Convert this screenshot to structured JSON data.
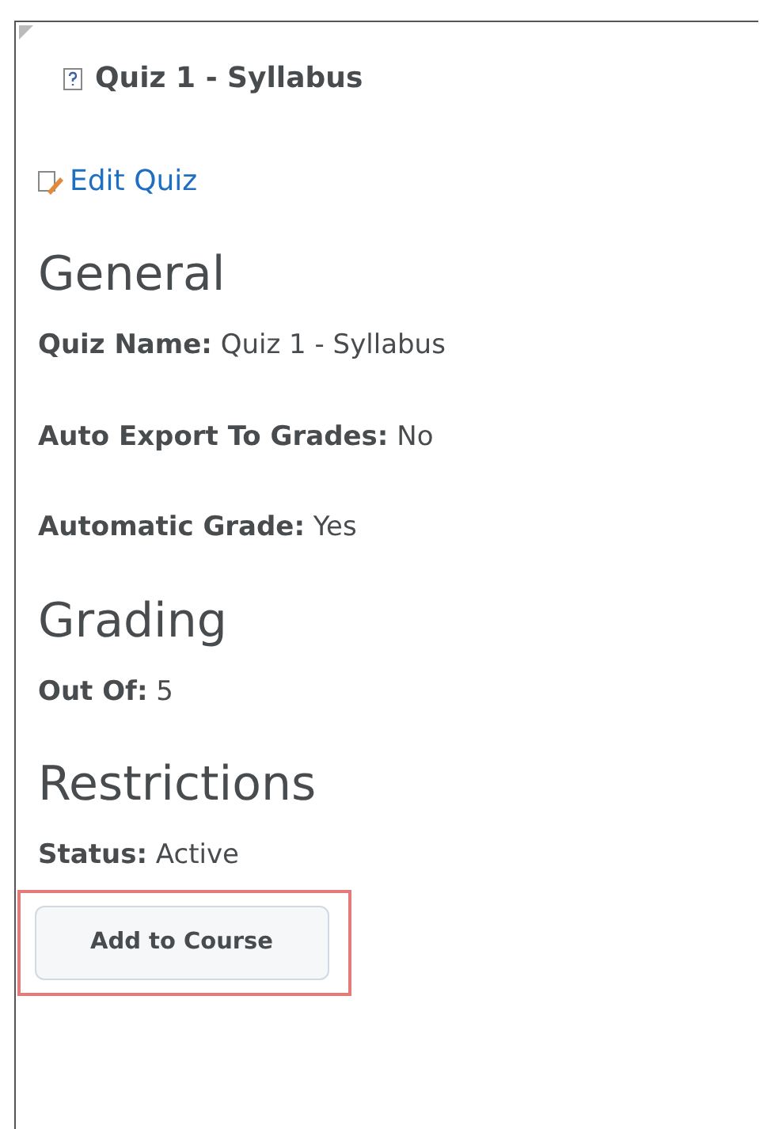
{
  "title": "Quiz 1 - Syllabus",
  "edit_link": "Edit Quiz",
  "sections": [
    {
      "heading": "General",
      "fields": [
        {
          "label": "Quiz Name:",
          "value": "Quiz 1 - Syllabus"
        },
        {
          "label": "Auto Export To Grades:",
          "value": "No"
        },
        {
          "label": "Automatic Grade:",
          "value": "Yes"
        }
      ]
    },
    {
      "heading": "Grading",
      "fields": [
        {
          "label": "Out Of:",
          "value": "5"
        }
      ]
    },
    {
      "heading": "Restrictions",
      "fields": [
        {
          "label": "Status:",
          "value": "Active"
        }
      ]
    }
  ],
  "button": {
    "label": "Add to Course",
    "highlighted": true
  }
}
